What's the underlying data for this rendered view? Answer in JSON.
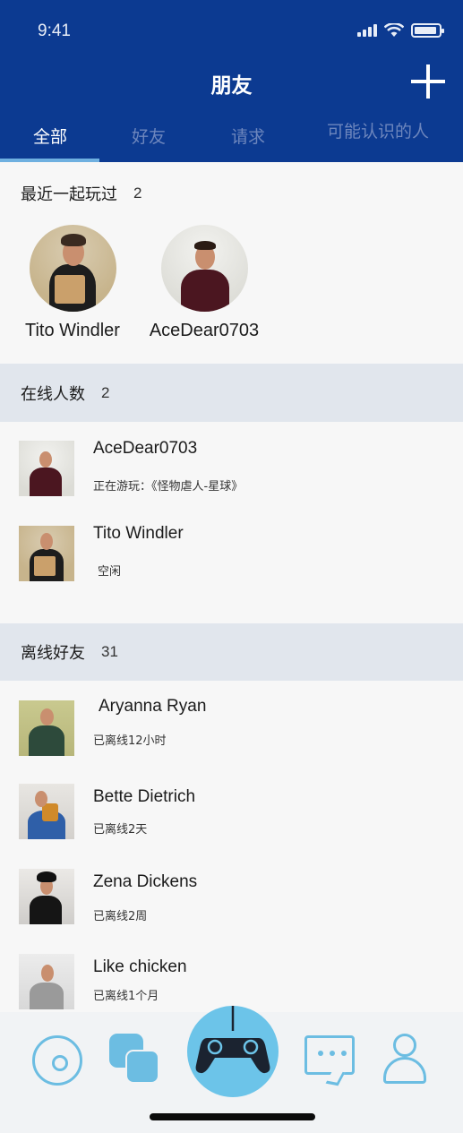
{
  "status_bar": {
    "time": "9:41"
  },
  "header": {
    "title": "朋友"
  },
  "tabs": [
    {
      "label": "全部",
      "active": true
    },
    {
      "label": "好友",
      "active": false
    },
    {
      "label": "请求",
      "active": false
    },
    {
      "label": "可能认识的人",
      "active": false
    }
  ],
  "recent": {
    "title": "最近一起玩过",
    "count": "2",
    "items": [
      {
        "name": "Tito Windler"
      },
      {
        "name": "AceDear0703"
      }
    ]
  },
  "online": {
    "title": "在线人数",
    "count": "2",
    "items": [
      {
        "name": "AceDear0703",
        "status": "正在游玩：《怪物虐人-星球》"
      },
      {
        "name": "Tito Windler",
        "status": "空闲"
      }
    ]
  },
  "offline": {
    "title": "离线好友",
    "count": "31",
    "items": [
      {
        "name": "Aryanna Ryan",
        "status": "已离线12小时"
      },
      {
        "name": "Bette Dietrich",
        "status": "已离线2天"
      },
      {
        "name": "Zena Dickens",
        "status": "已离线2周"
      },
      {
        "name": "Like chicken",
        "status": "已离线1个月"
      }
    ]
  },
  "tab_bar": {
    "items": [
      "disc-icon",
      "friends-icon",
      "gamepad-icon",
      "chat-icon",
      "profile-icon"
    ],
    "accent": "#6cbde2"
  },
  "colors": {
    "header_bg": "#0c3a91",
    "section_band": "#e1e6ed",
    "tab_active": "#ffffff",
    "tab_inactive": "#6d86bd"
  }
}
